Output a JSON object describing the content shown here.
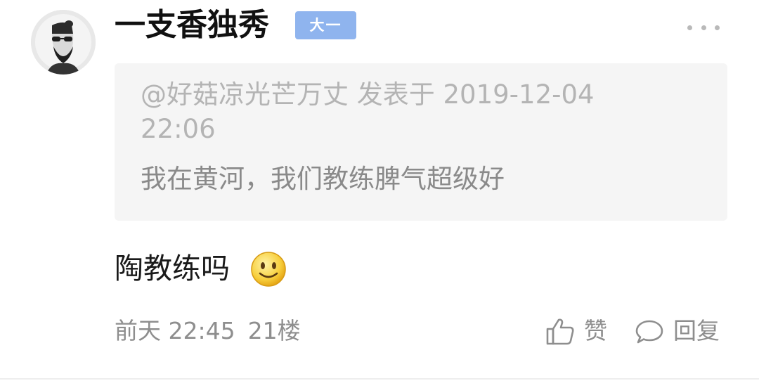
{
  "comment": {
    "author": {
      "name": "一支香独秀",
      "badge": "大一"
    },
    "quote": {
      "meta": "@好菇凉光芒万丈 发表于 2019-12-04 22:06",
      "text": "我在黄河，我们教练脾气超级好"
    },
    "text": "陶教练吗",
    "emoji": "smile-emoji",
    "time": "前天 22:45",
    "floor": "21楼",
    "actions": {
      "like_label": "赞",
      "reply_label": "回复"
    }
  },
  "colors": {
    "badge_bg": "#8fb4ee",
    "quote_bg": "#f5f5f5",
    "meta_text": "#8e8e8e"
  }
}
